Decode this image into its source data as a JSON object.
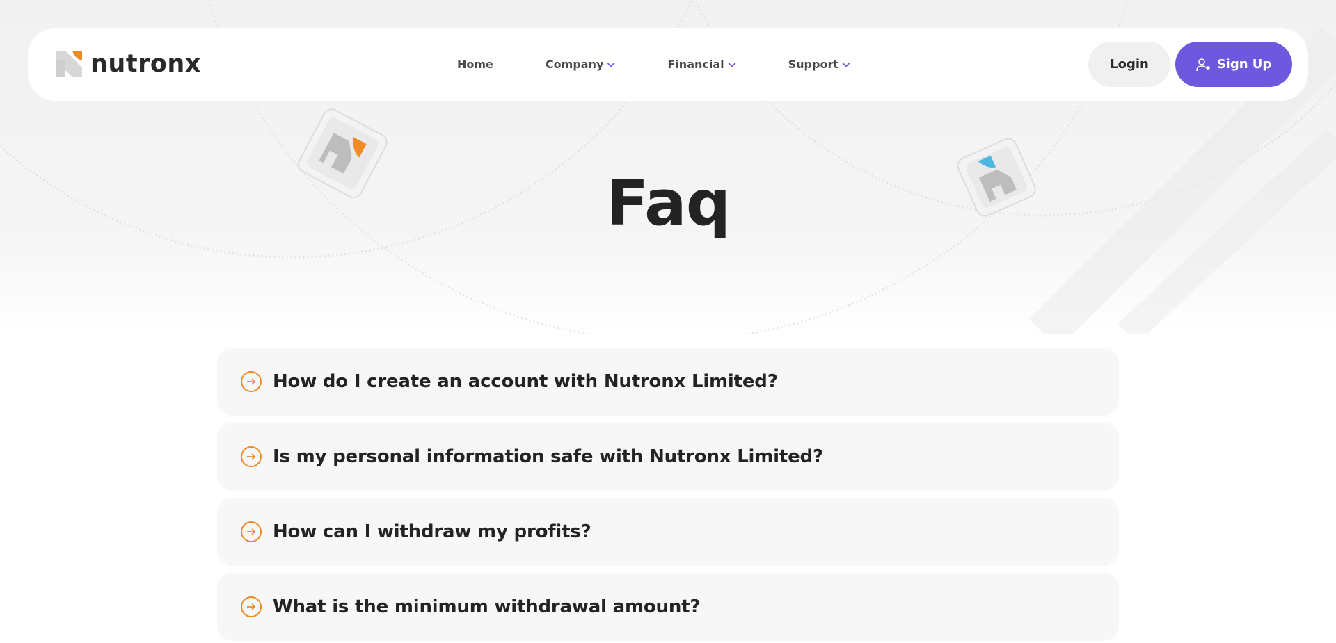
{
  "brand": {
    "name": "nutronx",
    "colors": {
      "orange": "#f08a24",
      "purple": "#6e58dd",
      "blue": "#4fb7e3",
      "text": "#232323"
    }
  },
  "nav": {
    "items": [
      {
        "label": "Home",
        "dropdown": false
      },
      {
        "label": "Company",
        "dropdown": true
      },
      {
        "label": "Financial",
        "dropdown": true
      },
      {
        "label": "Support",
        "dropdown": true
      }
    ]
  },
  "auth": {
    "login_label": "Login",
    "signup_label": "Sign Up"
  },
  "hero": {
    "title": "Faq"
  },
  "faq": {
    "items": [
      {
        "question": "How do I create an account with Nutronx Limited?"
      },
      {
        "question": "Is my personal information safe with Nutronx Limited?"
      },
      {
        "question": "How can I withdraw my profits?"
      },
      {
        "question": "What is the minimum withdrawal amount?"
      }
    ]
  }
}
